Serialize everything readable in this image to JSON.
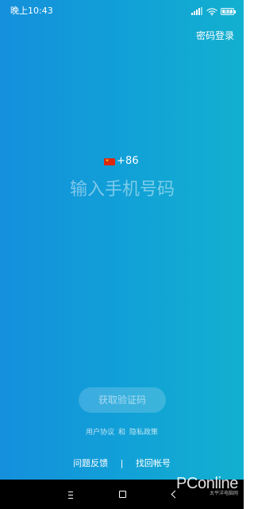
{
  "status_bar": {
    "time": "晚上10:43",
    "battery_text": "83",
    "icons": [
      "signal-icon",
      "wifi-icon",
      "battery-icon"
    ]
  },
  "top_right": {
    "password_login": "密码登录"
  },
  "login": {
    "country_flag": "china-flag-icon",
    "country_code": "+86",
    "phone_placeholder": "输入手机号码",
    "get_code_button": "获取验证码"
  },
  "agreements": {
    "user_agreement": "用户协议",
    "and_text": "和",
    "privacy_policy": "隐私政策"
  },
  "bottom_links": {
    "feedback": "问题反馈",
    "separator": "|",
    "recover_account": "找回帐号"
  },
  "navigation": {
    "icons": [
      "menu-icon",
      "home-icon",
      "back-icon"
    ]
  },
  "watermark": {
    "brand": "PConline",
    "subtitle": "太平洋电脑网"
  },
  "colors": {
    "gradient_start": "#1590dc",
    "gradient_end": "#12b0cf",
    "nav_bar": "#000000",
    "text": "#ffffff"
  }
}
